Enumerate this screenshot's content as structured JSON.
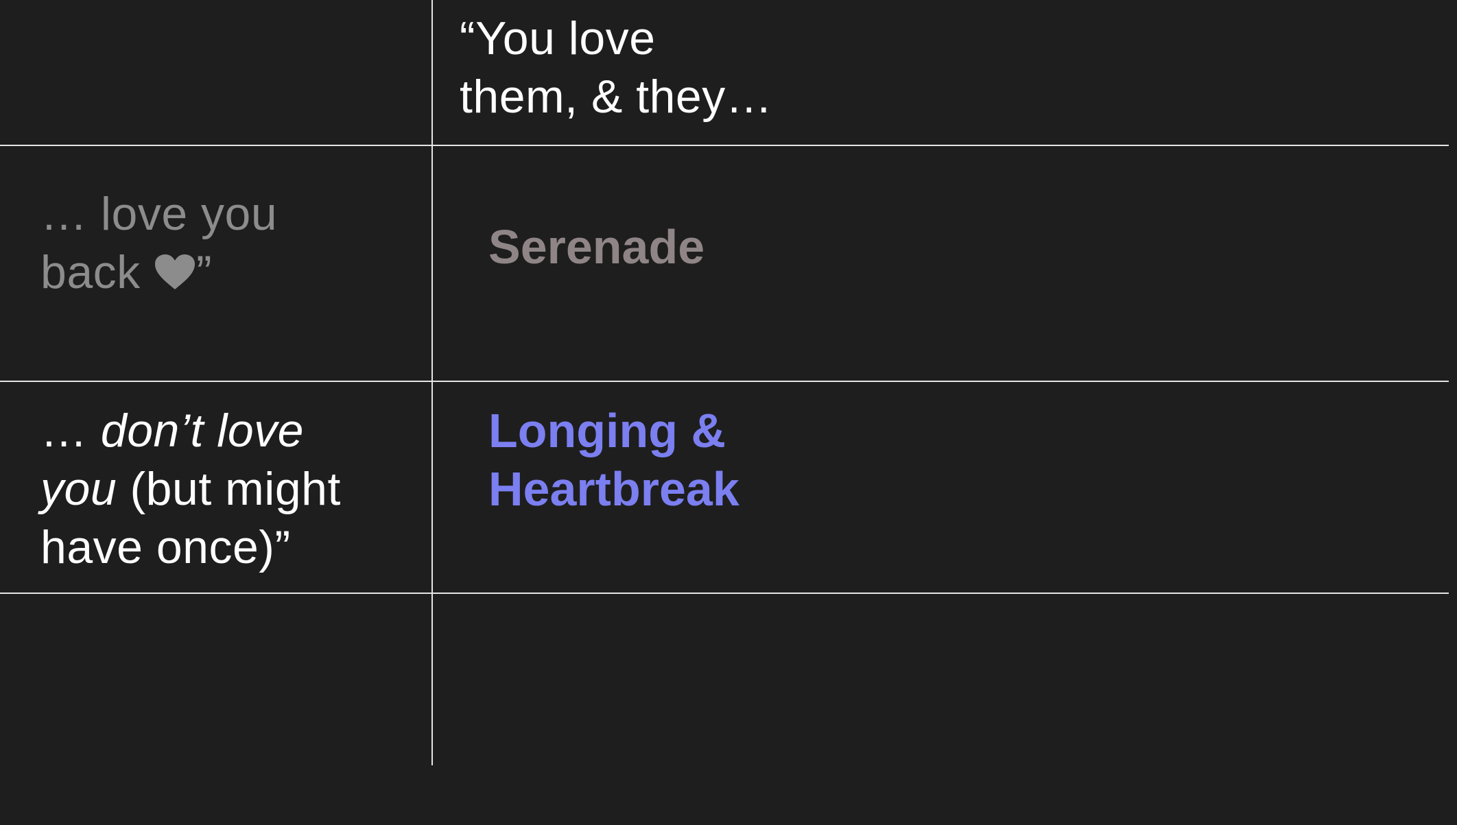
{
  "header": {
    "prompt_line1": "“You love",
    "prompt_line2": "them, & they…"
  },
  "rows": [
    {
      "label_line1": "… love you",
      "label_line2_text": "back ",
      "label_line2_end": "”",
      "heart_icon": "heart-icon",
      "category": "Serenade",
      "category_color": "#8f8587"
    },
    {
      "label_line1_prefix": "… ",
      "label_line1_em": "don’t love",
      "label_line2_em": "you",
      "label_line2_rest": " (but might",
      "label_line3": "have once)”",
      "category_line1": "Longing &",
      "category_line2": "Heartbreak",
      "category_color": "#7b7ff0"
    }
  ],
  "colors": {
    "background": "#1e1e1e",
    "grid_line": "#e6e6e6",
    "muted_text": "#8c8c8c",
    "primary_text": "#ffffff"
  }
}
